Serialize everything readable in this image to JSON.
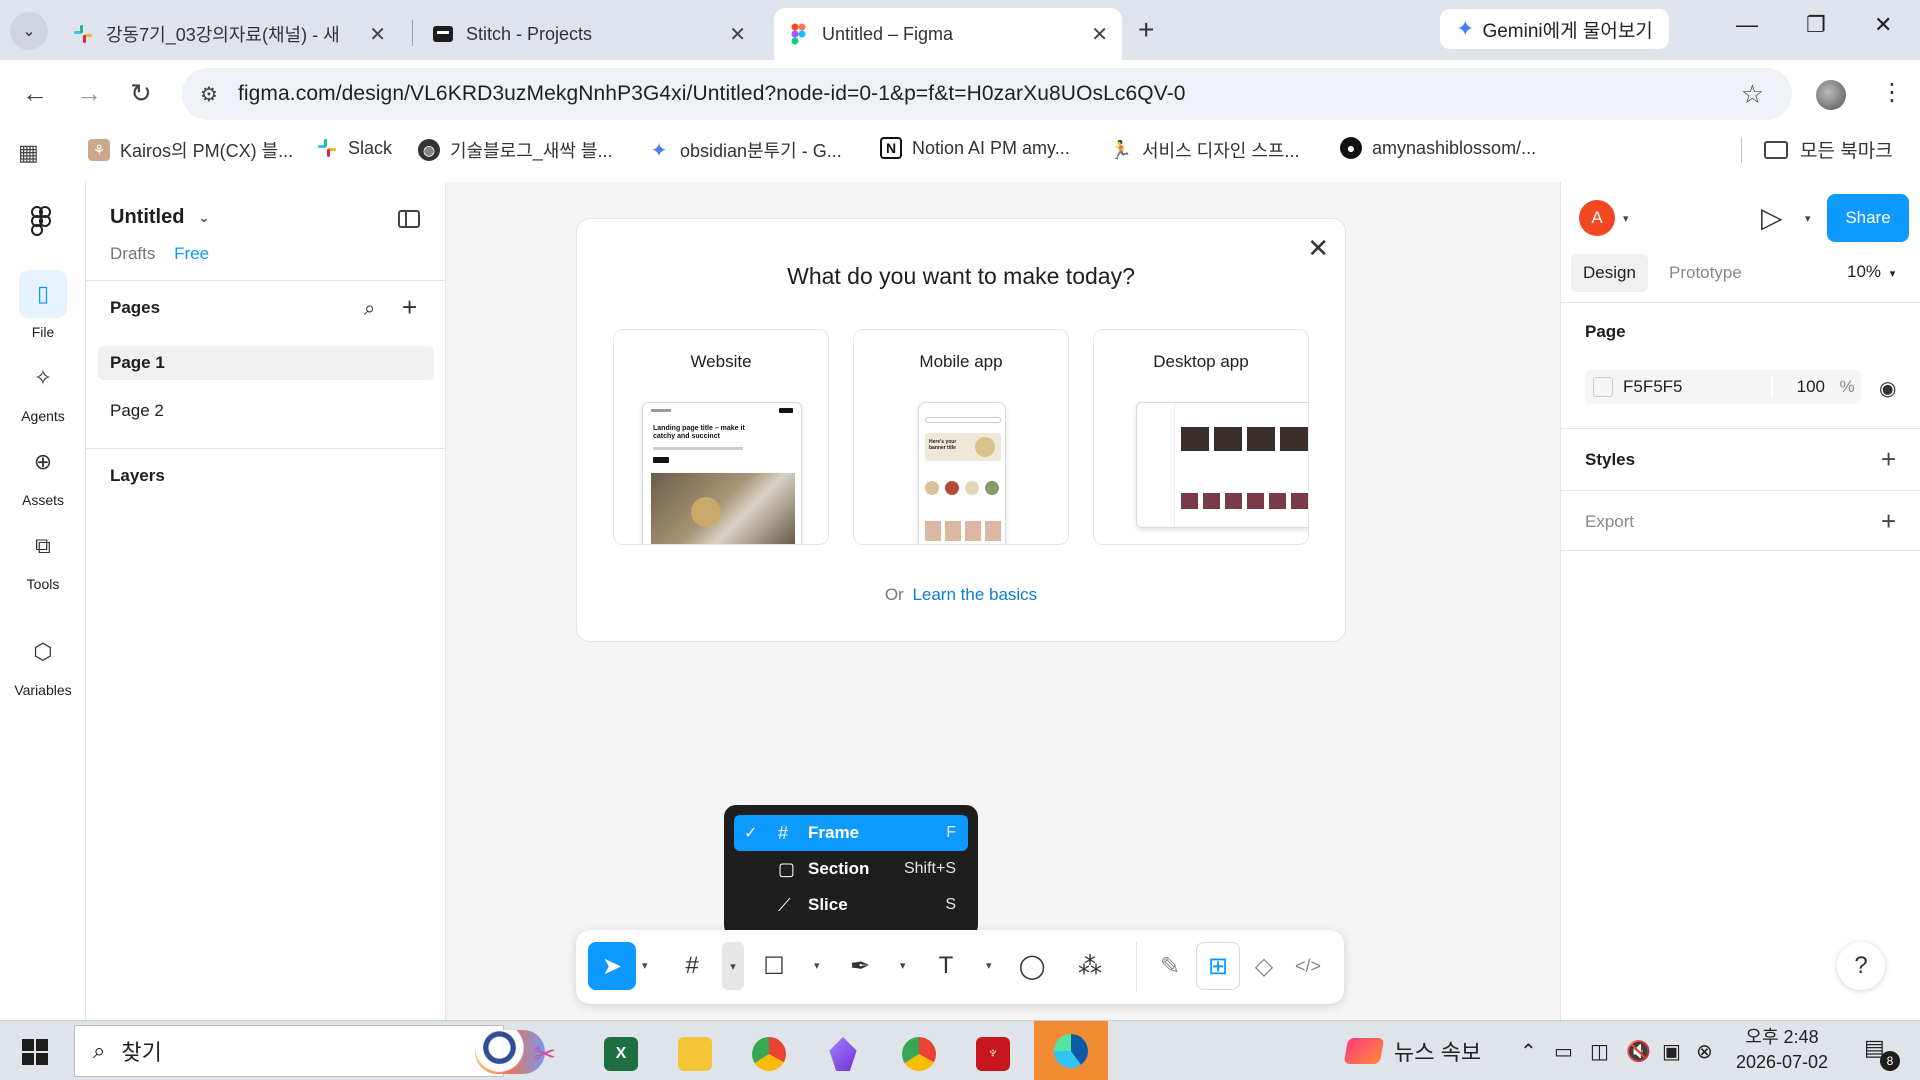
{
  "browser": {
    "tabs": [
      {
        "title": "강동7기_03강의자료(채널) - 새",
        "favicon": "slack-icon",
        "active": false
      },
      {
        "title": "Stitch - Projects",
        "favicon": "stitch-icon",
        "active": false
      },
      {
        "title": "Untitled – Figma",
        "favicon": "figma-icon",
        "active": true
      }
    ],
    "gemini_label": "Gemini에게 물어보기",
    "url": "figma.com/design/VL6KRD3uzMekgNnhP3G4xi/Untitled?node-id=0-1&p=f&t=H0zarXu8UOsLc6QV-0",
    "bookmarks": [
      {
        "label": "Kairos의 PM(CX) 블...",
        "icon": "kairos-icon"
      },
      {
        "label": "Slack",
        "icon": "slack-icon"
      },
      {
        "label": "기술블로그_새싹 블...",
        "icon": "globe-icon"
      },
      {
        "label": "obsidian분투기 - G...",
        "icon": "gemini-spark-icon"
      },
      {
        "label": "Notion AI PM amy...",
        "icon": "notion-icon"
      },
      {
        "label": "서비스 디자인 스프...",
        "icon": "runner-icon"
      },
      {
        "label": "amynashiblossom/...",
        "icon": "github-icon"
      }
    ],
    "bookmarks_folder": "모든 북마크"
  },
  "figma": {
    "rail": [
      {
        "label": "File",
        "icon": "file-icon",
        "active": true
      },
      {
        "label": "Agents",
        "icon": "agents-icon",
        "active": false
      },
      {
        "label": "Assets",
        "icon": "assets-icon",
        "active": false
      },
      {
        "label": "Tools",
        "icon": "toolbox-icon",
        "active": false
      },
      {
        "label": "Variables",
        "icon": "variables-icon",
        "active": false
      }
    ],
    "file_name": "Untitled",
    "location": "Drafts",
    "plan": "Free",
    "pages_heading": "Pages",
    "pages": [
      "Page 1",
      "Page 2"
    ],
    "layers_heading": "Layers",
    "welcome": {
      "title": "What do you want to make today?",
      "cards": [
        "Website",
        "Mobile app",
        "Desktop app"
      ],
      "website_thumb_headline": "Landing page title – make it catchy and succinct",
      "mobile_thumb_headline": "Here's your banner title",
      "learn_prefix": "Or",
      "learn_link": "Learn the basics"
    },
    "frame_menu": [
      {
        "label": "Frame",
        "shortcut": "F",
        "icon": "frame-icon",
        "checked": true
      },
      {
        "label": "Section",
        "shortcut": "Shift+S",
        "icon": "section-icon",
        "checked": false
      },
      {
        "label": "Slice",
        "shortcut": "S",
        "icon": "slice-icon",
        "checked": false
      }
    ],
    "right": {
      "user_initial": "A",
      "share_label": "Share",
      "tabs": [
        "Design",
        "Prototype"
      ],
      "zoom": "10%",
      "page_heading": "Page",
      "bg_color": "F5F5F5",
      "bg_opacity": "100",
      "opacity_unit": "%",
      "styles_heading": "Styles",
      "export_heading": "Export",
      "help": "?"
    }
  },
  "taskbar": {
    "search_placeholder": "찾기",
    "news_label": "뉴스 속보",
    "time": "오후 2:48",
    "date": "2026-07-02",
    "notifications": "8"
  },
  "colors": {
    "figma_blue": "#0d99ff",
    "avatar_red": "#f24822",
    "menu_dark": "#1e1e1e"
  }
}
